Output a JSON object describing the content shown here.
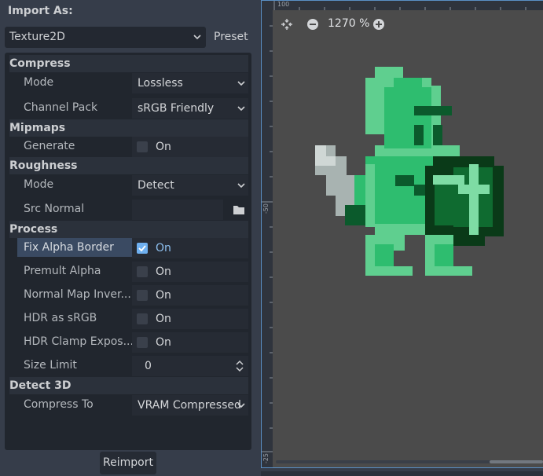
{
  "dock": {
    "title": "Import As:",
    "type_value": "Texture2D",
    "preset_label": "Preset"
  },
  "sections": {
    "compress": "Compress",
    "mipmaps": "Mipmaps",
    "roughness": "Roughness",
    "process": "Process",
    "detect3d": "Detect 3D"
  },
  "properties": {
    "compress_mode": {
      "label": "Mode",
      "value": "Lossless"
    },
    "channel_pack": {
      "label": "Channel Pack",
      "value": "sRGB Friendly"
    },
    "generate": {
      "label": "Generate",
      "value": "On",
      "checked": false
    },
    "roughness_mode": {
      "label": "Mode",
      "value": "Detect"
    },
    "src_normal": {
      "label": "Src Normal",
      "value": ""
    },
    "fix_alpha_border": {
      "label": "Fix Alpha Border",
      "value": "On",
      "checked": true
    },
    "premult_alpha": {
      "label": "Premult Alpha",
      "value": "On",
      "checked": false
    },
    "normal_map_invert": {
      "label": "Normal Map Inver...",
      "value": "On",
      "checked": false
    },
    "hdr_as_srgb": {
      "label": "HDR as sRGB",
      "value": "On",
      "checked": false
    },
    "hdr_clamp": {
      "label": "HDR Clamp Expos...",
      "value": "On",
      "checked": false
    },
    "size_limit": {
      "label": "Size Limit",
      "value": "0"
    },
    "compress_to": {
      "label": "Compress To",
      "value": "VRAM Compressed"
    }
  },
  "reimport_label": "Reimport",
  "viewport": {
    "zoom": "1270 %",
    "ruler_top": [
      "100"
    ],
    "ruler_left": [
      "-50",
      "-25"
    ]
  },
  "icons": {
    "zoom_reset": "center-view-icon",
    "zoom_out": "zoom-out-icon",
    "zoom_in": "zoom-in-icon",
    "folder": "folder-icon",
    "dropdown": "chevron-down-icon",
    "spin": "spinbox-arrows-icon"
  },
  "colors": {
    "accent": "#6fb0f0",
    "panel": "#21262e",
    "background": "#363d4a"
  }
}
